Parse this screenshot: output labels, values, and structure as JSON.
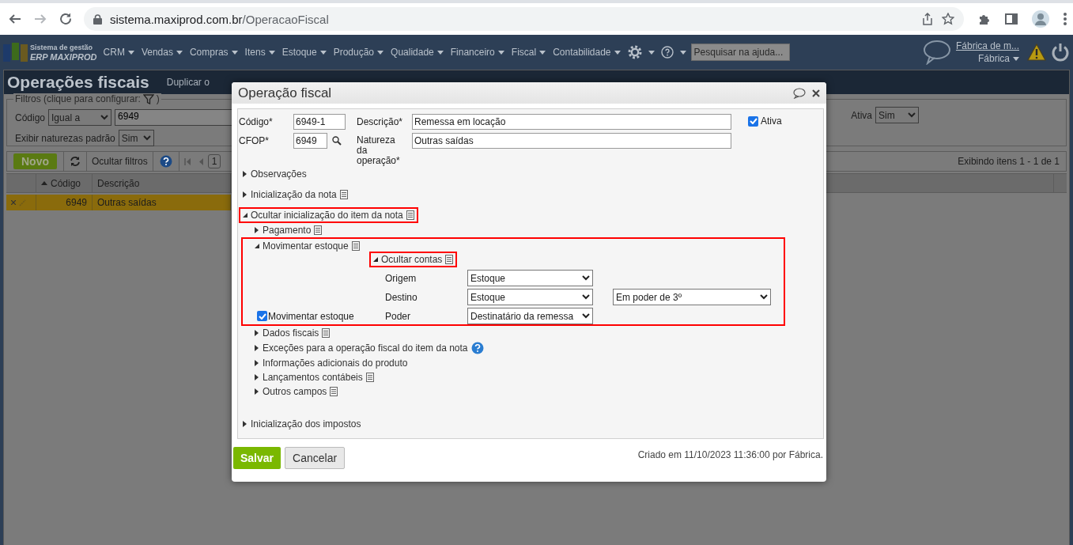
{
  "browser": {
    "url_host": "sistema.maxiprod.com.br",
    "url_path": "/OperacaoFiscal"
  },
  "app_header": {
    "logo_line1": "Sistema de gestão",
    "logo_line2": "ERP MAXIPROD",
    "menu": [
      "CRM",
      "Vendas",
      "Compras",
      "Itens",
      "Estoque",
      "Produção",
      "Qualidade",
      "Financeiro",
      "Fiscal",
      "Contabilidade"
    ],
    "search_placeholder": "Pesquisar na ajuda...",
    "user_name": "Fábrica de m...",
    "company": "Fábrica"
  },
  "page": {
    "title": "Operações fiscais",
    "toolbar_action": "Duplicar o"
  },
  "filters": {
    "legend": "Filtros (clique para configurar:",
    "legend_end": ")",
    "code_filter": {
      "label": "Código",
      "operator": "Igual a",
      "value": "6949"
    },
    "active_filter": {
      "label": "Ativa",
      "value": "Sim"
    },
    "default_natures": {
      "label": "Exibir naturezas padrão",
      "value": "Sim"
    }
  },
  "grid_toolbar": {
    "new_button": "Novo",
    "hide_filters": "Ocultar filtros",
    "page": "1",
    "summary": "Exibindo itens 1 - 1 de 1"
  },
  "grid": {
    "columns": [
      {
        "label": "Código",
        "sorted": true
      },
      {
        "label": "Descrição",
        "sorted": false
      }
    ],
    "rows": [
      {
        "codigo": "6949",
        "descricao": "Outras saídas",
        "selected": true
      }
    ]
  },
  "dialog": {
    "title": "Operação fiscal",
    "fields": {
      "codigo_label": "Código*",
      "codigo": "6949-1",
      "descricao_label": "Descrição*",
      "descricao": "Remessa em locação",
      "ativa_label": "Ativa",
      "ativa_checked": true,
      "cfop_label": "CFOP*",
      "cfop": "6949",
      "natureza_label": "Natureza da operação*",
      "natureza": "Outras saídas"
    },
    "sections": [
      {
        "label": "Observações",
        "expanded": false,
        "note": false,
        "help": false,
        "highlighted": false
      },
      {
        "label": "Inicialização da nota",
        "expanded": false,
        "note": true,
        "help": false,
        "highlighted": false
      },
      {
        "label": "Ocultar inicialização do item da nota",
        "expanded": true,
        "note": true,
        "help": false,
        "highlighted": true,
        "children": [
          {
            "label": "Pagamento",
            "expanded": false,
            "note": true,
            "help": false,
            "highlighted": false
          },
          {
            "label": "Movimentar estoque",
            "expanded": true,
            "note": true,
            "help": false,
            "highlighted": true,
            "kind": "stock",
            "panel": {
              "accounts": {
                "label": "Ocultar contas",
                "expanded": true,
                "note": true,
                "help": false,
                "highlighted": true
              },
              "fields": [
                {
                  "label": "Origem",
                  "value": "Estoque"
                },
                {
                  "label": "Destino",
                  "value": "Estoque",
                  "extra": "Em poder de 3º"
                },
                {
                  "label": "Poder",
                  "value": "Destinatário da remessa"
                }
              ],
              "move_stock": {
                "label": "Movimentar estoque",
                "checked": true
              }
            }
          },
          {
            "label": "Dados fiscais",
            "expanded": false,
            "note": true,
            "help": false,
            "highlighted": false
          },
          {
            "label": "Exceções para a operação fiscal do item da nota",
            "expanded": false,
            "note": false,
            "help": true,
            "highlighted": false
          },
          {
            "label": "Informações adicionais do produto",
            "expanded": false,
            "note": false,
            "help": false,
            "highlighted": false
          },
          {
            "label": "Lançamentos contábeis",
            "expanded": false,
            "note": true,
            "help": false,
            "highlighted": false
          },
          {
            "label": "Outros campos",
            "expanded": false,
            "note": true,
            "help": false,
            "highlighted": false
          }
        ]
      },
      {
        "label": "Inicialização dos impostos",
        "expanded": false,
        "note": false,
        "help": false,
        "highlighted": false
      }
    ],
    "footer": {
      "save": "Salvar",
      "cancel": "Cancelar",
      "created": "Criado em 11/10/2023 11:36:00 por Fábrica."
    }
  }
}
